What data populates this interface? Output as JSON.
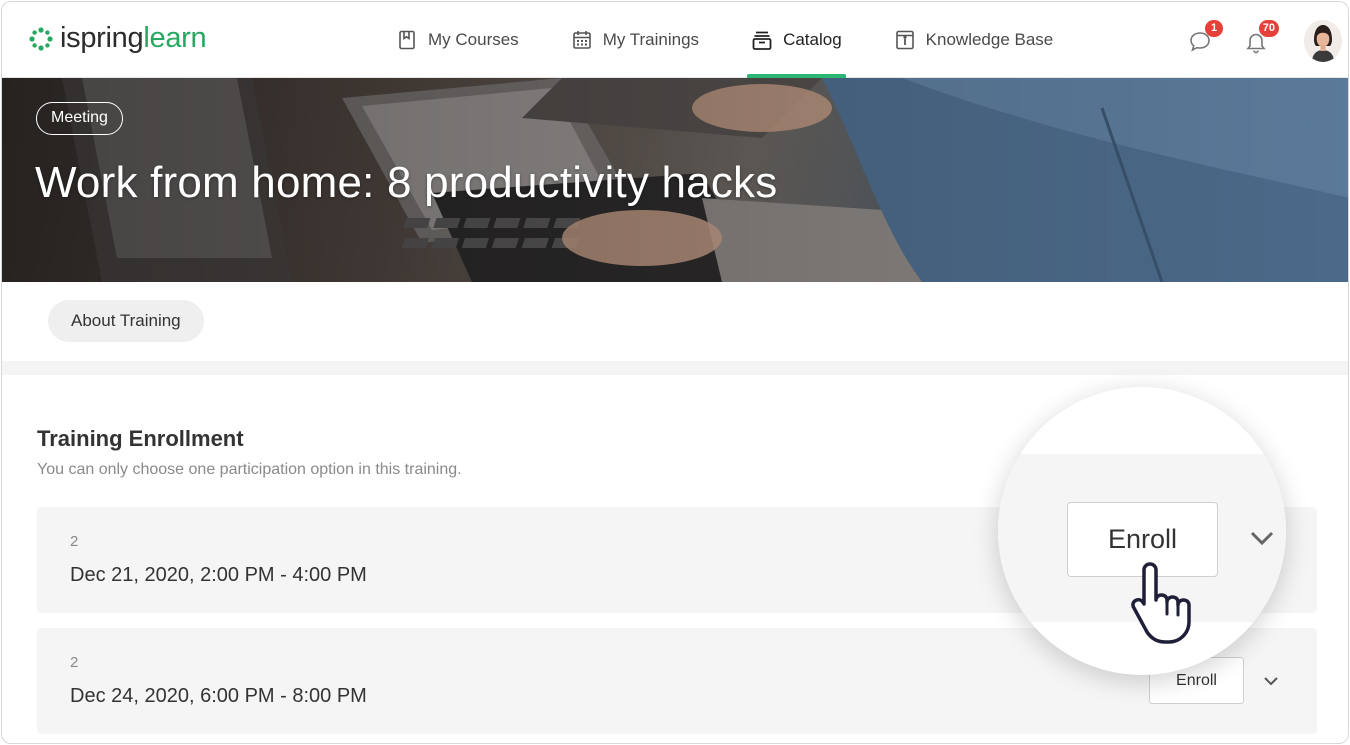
{
  "brand": {
    "part1": "ispring",
    "part2": "learn",
    "accent": "#27a860"
  },
  "nav": {
    "items": [
      {
        "label": "My Courses",
        "icon": "book-icon"
      },
      {
        "label": "My Trainings",
        "icon": "calendar-icon"
      },
      {
        "label": "Catalog",
        "icon": "catalog-icon",
        "active": true
      },
      {
        "label": "Knowledge Base",
        "icon": "knowledge-base-icon"
      }
    ]
  },
  "header": {
    "messages_badge": "1",
    "notifications_badge": "70",
    "badge_color": "#e4413a",
    "active_tab_color": "#2bb673"
  },
  "hero": {
    "tag": "Meeting",
    "title": "Work from home: 8 productivity hacks"
  },
  "tabs": {
    "about": "About Training"
  },
  "enrollment": {
    "title": "Training Enrollment",
    "subtitle": "You can only choose one participation option in this training.",
    "sessions": [
      {
        "number": "2",
        "date": "Dec 21, 2020, 2:00 PM - 4:00 PM",
        "button": "Enroll"
      },
      {
        "number": "2",
        "date": "Dec 24, 2020, 6:00 PM - 8:00 PM",
        "button": "Enroll"
      }
    ]
  },
  "magnifier": {
    "button": "Enroll"
  }
}
